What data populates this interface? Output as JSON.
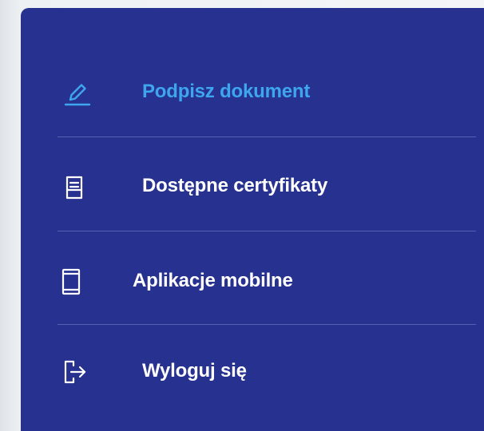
{
  "menu": {
    "items": [
      {
        "label": "Podpisz dokument",
        "icon": "pen-icon",
        "active": true
      },
      {
        "label": "Dostępne certyfikaty",
        "icon": "document-icon",
        "active": false
      },
      {
        "label": "Aplikacje mobilne",
        "icon": "mobile-device-icon",
        "active": false
      },
      {
        "label": "Wyloguj się",
        "icon": "logout-icon",
        "active": false
      }
    ]
  },
  "colors": {
    "panel_background": "#27318f",
    "active_text": "#3ea6ef",
    "text": "#ffffff",
    "divider": "#5560b0"
  }
}
